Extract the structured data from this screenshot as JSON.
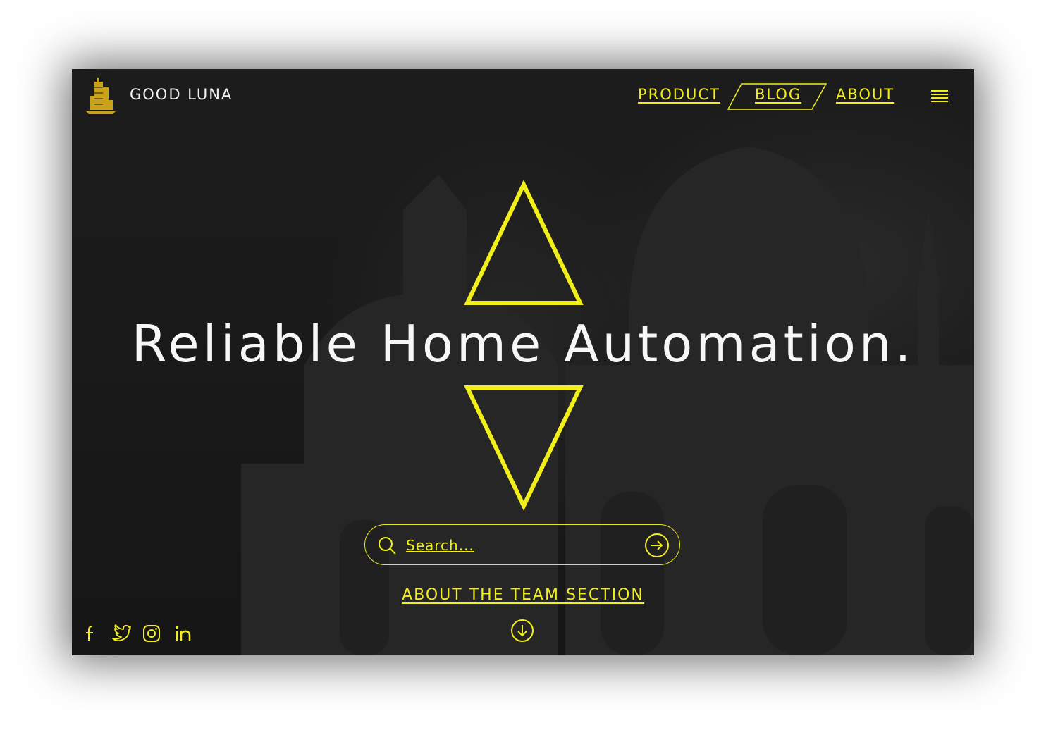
{
  "brand": {
    "name": "GOOD LUNA",
    "logo_icon": "building-icon"
  },
  "nav": {
    "product": "PRODUCT",
    "blog": "BLOG",
    "about": "ABOUT",
    "menu_icon": "hamburger-menu-icon"
  },
  "hero": {
    "headline": "Reliable Home Automation."
  },
  "search": {
    "placeholder": "Search...",
    "icon": "search-icon",
    "submit_icon": "arrow-right-circle-icon"
  },
  "team_link": {
    "label": "ABOUT THE TEAM SECTION",
    "icon": "arrow-down-circle-icon"
  },
  "social": [
    "facebook-icon",
    "twitter-icon",
    "instagram-icon",
    "linkedin-icon"
  ],
  "colors": {
    "accent": "#f2ee1a",
    "background": "#1a1a1a",
    "text": "#f7f7f7"
  }
}
